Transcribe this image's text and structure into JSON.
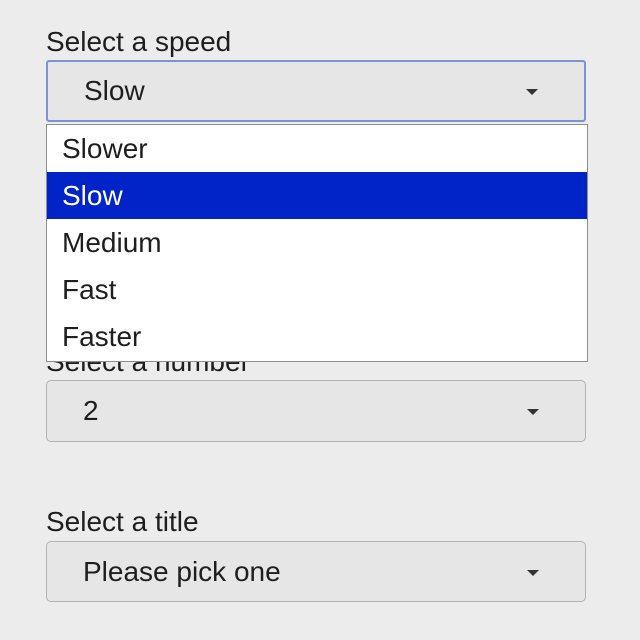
{
  "speed": {
    "label": "Select a speed",
    "selected": "Slow",
    "options": [
      "Slower",
      "Slow",
      "Medium",
      "Fast",
      "Faster"
    ]
  },
  "number": {
    "label": "Select a number",
    "selected": "2"
  },
  "title": {
    "label": "Select a title",
    "selected": "Please pick one"
  },
  "colors": {
    "background": "#ececec",
    "focus_border": "#7b93d4",
    "highlight": "#0024c8"
  },
  "icons": {
    "dropdown_arrow": "chevron-down-icon"
  }
}
